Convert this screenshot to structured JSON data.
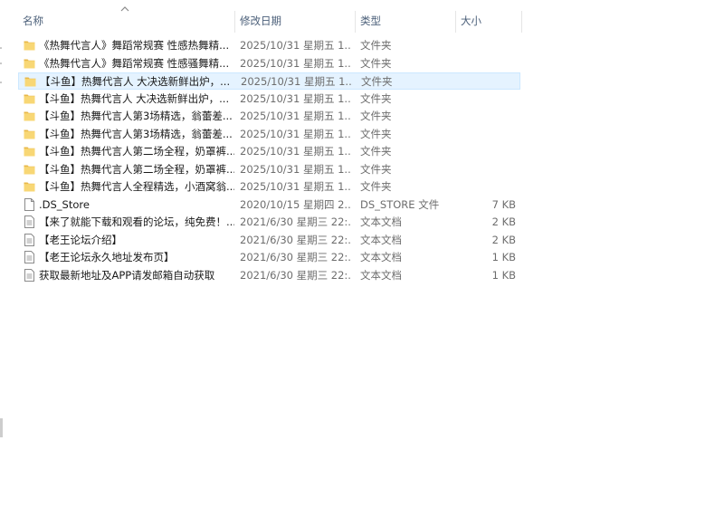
{
  "columns": {
    "name": "名称",
    "date": "修改日期",
    "type": "类型",
    "size": "大小"
  },
  "files": [
    {
      "icon": "folder-icon",
      "name": "《热舞代言人》舞蹈常规赛 性感热舞精...",
      "date": "2025/10/31 星期五 1...",
      "type": "文件夹",
      "size": ""
    },
    {
      "icon": "folder-icon",
      "name": "《热舞代言人》舞蹈常规赛 性感骚舞精...",
      "date": "2025/10/31 星期五 1...",
      "type": "文件夹",
      "size": ""
    },
    {
      "icon": "folder-icon",
      "name": "【斗鱼】热舞代言人 大决选新鲜出炉，...",
      "date": "2025/10/31 星期五 1...",
      "type": "文件夹",
      "size": "",
      "selected": true
    },
    {
      "icon": "folder-icon",
      "name": "【斗鱼】热舞代言人 大决选新鲜出炉，...",
      "date": "2025/10/31 星期五 1...",
      "type": "文件夹",
      "size": ""
    },
    {
      "icon": "folder-icon",
      "name": "【斗鱼】热舞代言人第3场精选，翁蕾差...",
      "date": "2025/10/31 星期五 1...",
      "type": "文件夹",
      "size": ""
    },
    {
      "icon": "folder-icon",
      "name": "【斗鱼】热舞代言人第3场精选，翁蕾差...",
      "date": "2025/10/31 星期五 1...",
      "type": "文件夹",
      "size": ""
    },
    {
      "icon": "folder-icon",
      "name": "【斗鱼】热舞代言人第二场全程，奶罩裤...",
      "date": "2025/10/31 星期五 1...",
      "type": "文件夹",
      "size": ""
    },
    {
      "icon": "folder-icon",
      "name": "【斗鱼】热舞代言人第二场全程，奶罩裤...",
      "date": "2025/10/31 星期五 1...",
      "type": "文件夹",
      "size": ""
    },
    {
      "icon": "folder-icon",
      "name": "【斗鱼】热舞代言人全程精选，小酒窝翁...",
      "date": "2025/10/31 星期五 1...",
      "type": "文件夹",
      "size": ""
    },
    {
      "icon": "file-icon",
      "name": ".DS_Store",
      "date": "2020/10/15 星期四 2...",
      "type": "DS_STORE 文件",
      "size": "7 KB"
    },
    {
      "icon": "text-file-icon",
      "name": "【来了就能下载和观看的论坛，纯免费！...",
      "date": "2021/6/30 星期三 22:...",
      "type": "文本文档",
      "size": "2 KB"
    },
    {
      "icon": "text-file-icon",
      "name": "【老王论坛介绍】",
      "date": "2021/6/30 星期三 22:...",
      "type": "文本文档",
      "size": "2 KB"
    },
    {
      "icon": "text-file-icon",
      "name": "【老王论坛永久地址发布页】",
      "date": "2021/6/30 星期三 22:...",
      "type": "文本文档",
      "size": "1 KB"
    },
    {
      "icon": "text-file-icon",
      "name": "获取最新地址及APP请发邮箱自动获取",
      "date": "2021/6/30 星期三 22:...",
      "type": "文本文档",
      "size": "1 KB"
    }
  ],
  "colors": {
    "folder": "#f8d775",
    "folder_dark": "#e8b84a",
    "selection_bg": "#e5f3ff",
    "selection_border": "#cce8ff",
    "header_text": "#4c607a",
    "secondary_text": "#6d6d6d"
  }
}
